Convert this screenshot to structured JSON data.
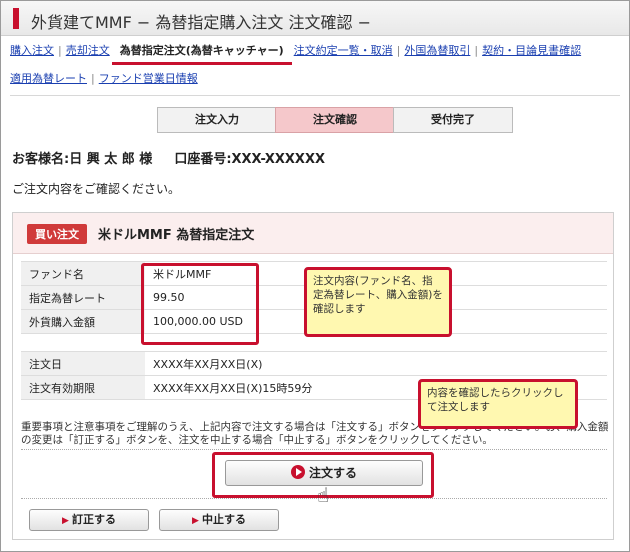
{
  "title": "外貨建てMMF − 為替指定購入注文 注文確認 −",
  "nav": {
    "row1": [
      "購入注文",
      "売却注文",
      "為替指定注文(為替キャッチャー)",
      "注文約定一覧・取消",
      "外国為替取引",
      "契約・目論見書確認"
    ],
    "row2": [
      "適用為替レート",
      "ファンド営業日情報"
    ]
  },
  "steps": [
    "注文入力",
    "注文確認",
    "受付完了"
  ],
  "customer": {
    "name": "お客様名:日 興 太 郎 様",
    "account": "口座番号:XXX-XXXXXX"
  },
  "confirm_message": "ご注文内容をご確認ください。",
  "order": {
    "badge": "買い注文",
    "title": "米ドルMMF 為替指定注文",
    "rows": [
      {
        "label": "ファンド名",
        "value": "米ドルMMF"
      },
      {
        "label": "指定為替レート",
        "value": "99.50"
      },
      {
        "label": "外貨購入金額",
        "value": "100,000.00 USD"
      }
    ],
    "rows2": [
      {
        "label": "注文日",
        "value": "XXXX年XX月XX日(X)"
      },
      {
        "label": "注文有効期限",
        "value": "XXXX年XX月XX日(X)15時59分"
      }
    ]
  },
  "callouts": {
    "values": "注文内容(ファンド名、指定為替レート、購入金額)を確認します",
    "order_button": "内容を確認したらクリックして注文します"
  },
  "notice": "重要事項と注意事項をご理解のうえ、上記内容で注文する場合は「注文する」ボタンをクリックしてください。お、購入金額の変更は「訂正する」ボタンを、注文を中止する場合「中止する」ボタンをクリックしてください。",
  "buttons": {
    "order": "注文する",
    "correct": "訂正する",
    "cancel": "中止する"
  },
  "colors": {
    "accent": "#c8102e",
    "callout_bg": "#fff8b0",
    "active_step": "#f5c8cb"
  },
  "icons": {
    "order_button": "play-circle-icon",
    "small_buttons": "arrow-right-icon",
    "pointer": "hand-cursor-icon"
  }
}
